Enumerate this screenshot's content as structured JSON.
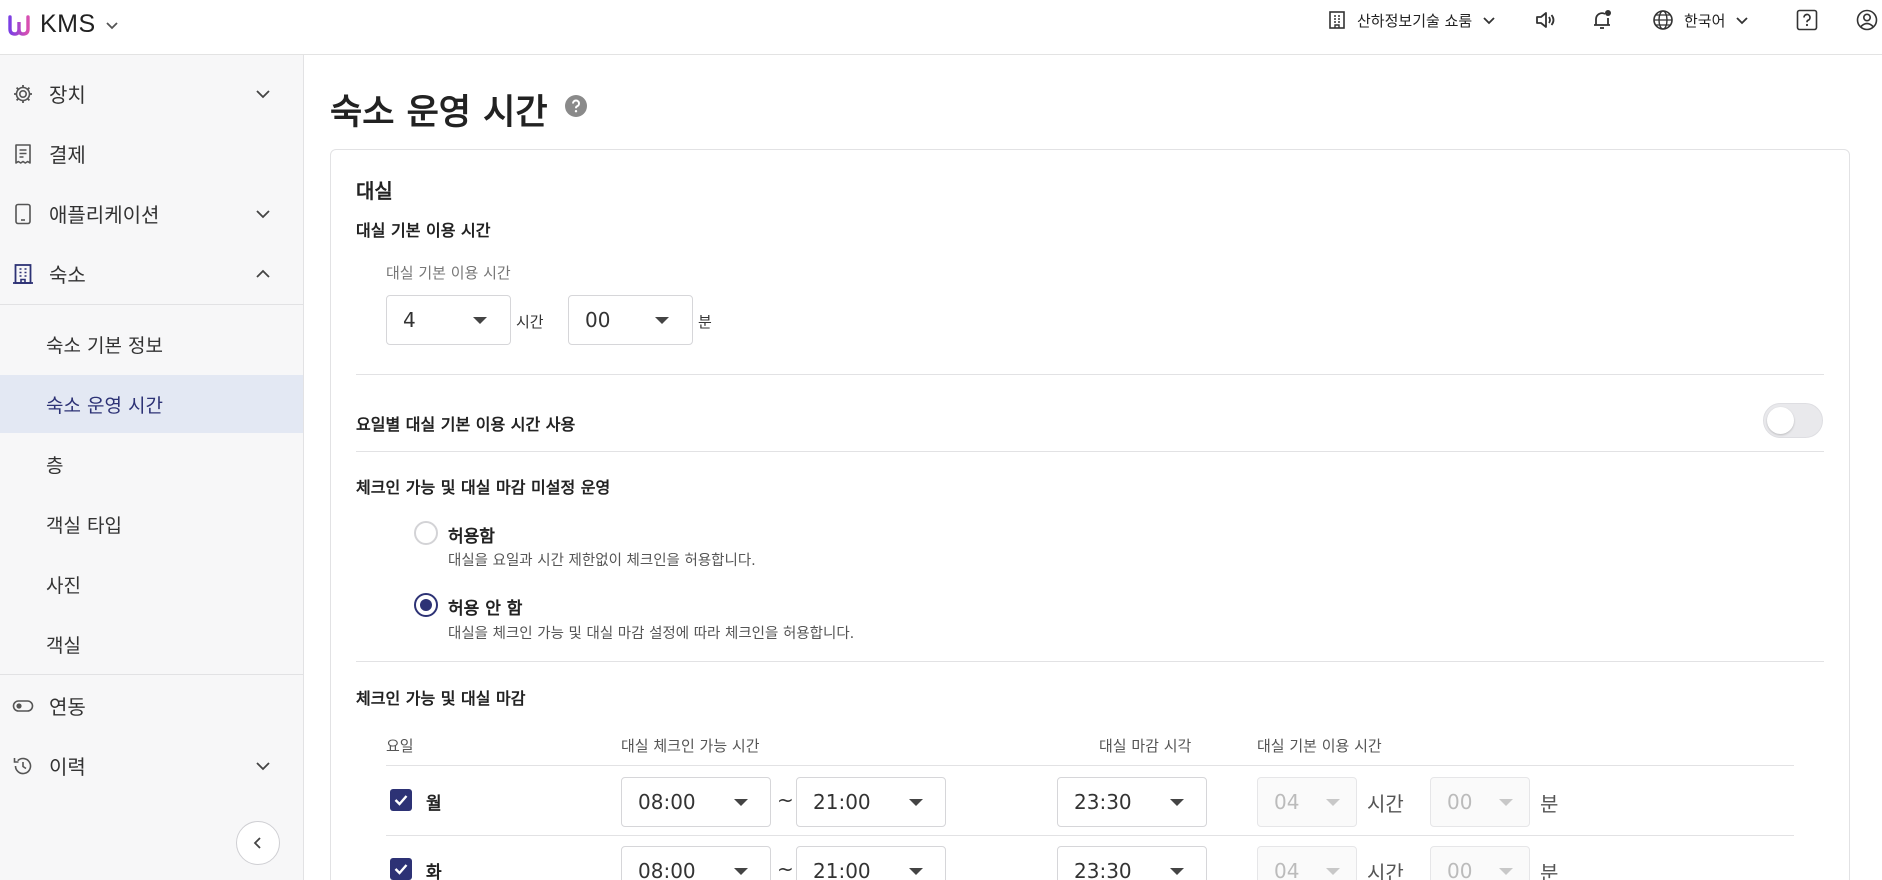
{
  "app": {
    "name": "KMS"
  },
  "header": {
    "store": "산하정보기술 쇼룸",
    "language": "한국어"
  },
  "sidebar": {
    "items": [
      {
        "label": "장치"
      },
      {
        "label": "결제"
      },
      {
        "label": "애플리케이션"
      },
      {
        "label": "숙소"
      },
      {
        "label": "연동"
      },
      {
        "label": "이력"
      }
    ],
    "sub_items": [
      {
        "label": "숙소 기본 정보"
      },
      {
        "label": "숙소 운영 시간"
      },
      {
        "label": "층"
      },
      {
        "label": "객실 타입"
      },
      {
        "label": "사진"
      },
      {
        "label": "객실"
      }
    ]
  },
  "page": {
    "title": "숙소 운영 시간"
  },
  "rental": {
    "section_title": "대실",
    "basic_title": "대실 기본 이용 시간",
    "basic_field_label": "대실 기본 이용 시간",
    "hours_value": "4",
    "hours_unit": "시간",
    "minutes_value": "00",
    "minutes_unit": "분",
    "weekday_toggle_label": "요일별 대실 기본 이용 시간 사용",
    "weekday_toggle_on": false,
    "unset_title": "체크인 가능 및 대실 마감 미설정 운영",
    "options": [
      {
        "label": "허용함",
        "desc": "대실을 요일과 시간 제한없이 체크인을 허용합니다.",
        "selected": false
      },
      {
        "label": "허용 안 함",
        "desc": "대실을 체크인 가능 및 대실 마감 설정에 따라 체크인을 허용합니다.",
        "selected": true
      }
    ],
    "schedule_title": "체크인 가능 및 대실 마감",
    "table_headers": [
      "요일",
      "대실 체크인 가능 시간",
      "대실 마감 시각",
      "대실 기본 이용 시간"
    ],
    "rows": [
      {
        "day": "월",
        "checked": true,
        "start": "08:00",
        "sep": "~",
        "end": "21:00",
        "close": "23:30",
        "hours": "04",
        "hours_unit": "시간",
        "minutes": "00",
        "minutes_unit": "분"
      },
      {
        "day": "화",
        "checked": true,
        "start": "08:00",
        "sep": "~",
        "end": "21:00",
        "close": "23:30",
        "hours": "04",
        "hours_unit": "시간",
        "minutes": "00",
        "minutes_unit": "분"
      }
    ]
  },
  "colors": {
    "accent": "#2d3275",
    "active_bg": "#e3e8f3",
    "sidebar_bg": "#f7f7f8"
  }
}
